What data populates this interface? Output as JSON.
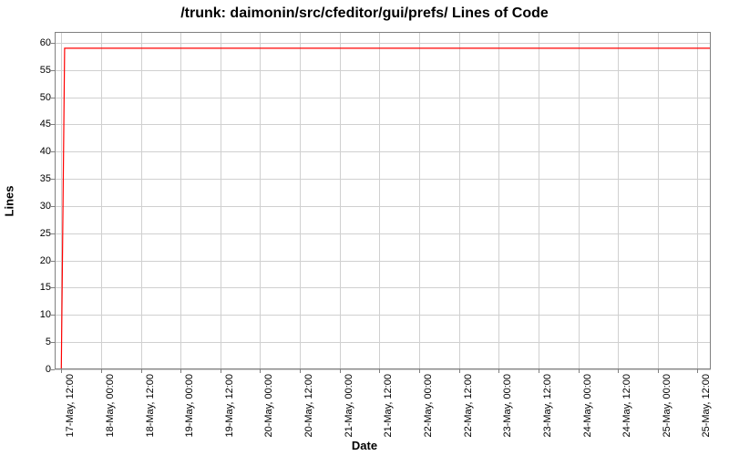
{
  "chart_data": {
    "type": "line",
    "title": "/trunk: daimonin/src/cfeditor/gui/prefs/ Lines of Code",
    "xlabel": "Date",
    "ylabel": "Lines",
    "ylim": [
      0,
      62
    ],
    "y_ticks": [
      0,
      5,
      10,
      15,
      20,
      25,
      30,
      35,
      40,
      45,
      50,
      55,
      60
    ],
    "x_ticks": [
      "17-May, 12:00",
      "18-May, 00:00",
      "18-May, 12:00",
      "19-May, 00:00",
      "19-May, 12:00",
      "20-May, 00:00",
      "20-May, 12:00",
      "21-May, 00:00",
      "21-May, 12:00",
      "22-May, 00:00",
      "22-May, 12:00",
      "23-May, 00:00",
      "23-May, 12:00",
      "24-May, 00:00",
      "24-May, 12:00",
      "25-May, 00:00",
      "25-May, 12:00"
    ],
    "series": [
      {
        "name": "Lines of Code",
        "color": "#ff0000",
        "x": [
          "17-May, 12:00",
          "17-May, 13:00",
          "25-May, 16:00"
        ],
        "values": [
          0,
          59,
          59
        ]
      }
    ]
  }
}
